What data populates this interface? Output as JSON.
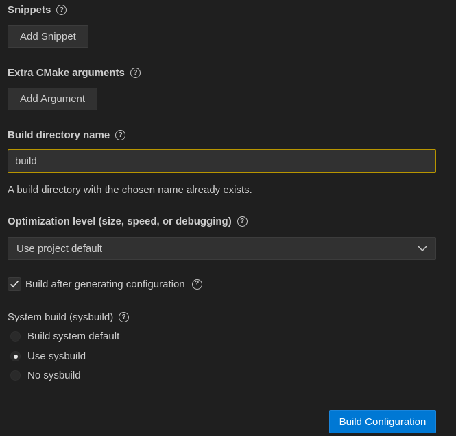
{
  "snippets": {
    "title": "Snippets",
    "add_button": "Add Snippet"
  },
  "cmake_args": {
    "title": "Extra CMake arguments",
    "add_button": "Add Argument"
  },
  "build_dir": {
    "title": "Build directory name",
    "value": "build",
    "warning": "A build directory with the chosen name already exists."
  },
  "optimization": {
    "title": "Optimization level (size, speed, or debugging)",
    "selected": "Use project default"
  },
  "build_after": {
    "label": "Build after generating configuration",
    "checked": true
  },
  "sysbuild": {
    "title": "System build (sysbuild)",
    "options": [
      {
        "label": "Build system default",
        "checked": false
      },
      {
        "label": "Use sysbuild",
        "checked": true
      },
      {
        "label": "No sysbuild",
        "checked": false
      }
    ]
  },
  "actions": {
    "build_configuration": "Build Configuration"
  },
  "colors": {
    "background": "#1f1f1f",
    "input_warning_border": "#b89500",
    "primary_button": "#0078d4"
  },
  "icons": {
    "help": "question-mark-circle-icon",
    "chevron": "chevron-down-icon",
    "check": "check-icon"
  }
}
